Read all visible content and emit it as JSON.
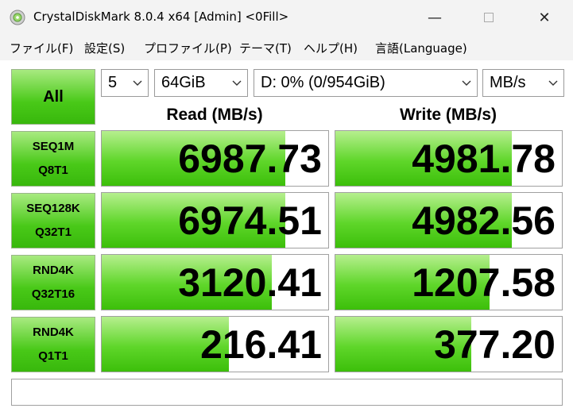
{
  "window": {
    "title": "CrystalDiskMark 8.0.4 x64 [Admin] <0Fill>",
    "min_symbol": "—",
    "close_symbol": "✕"
  },
  "menu": {
    "file": "ファイル(F)",
    "settings": "設定(S)",
    "profile": "プロファイル(P)",
    "theme": "テーマ(T)",
    "help": "ヘルプ(H)",
    "language": "言語(Language)"
  },
  "controls": {
    "all_label": "All",
    "count": "5",
    "size": "64GiB",
    "drive": "D: 0% (0/954GiB)",
    "unit": "MB/s"
  },
  "headers": {
    "read": "Read (MB/s)",
    "write": "Write (MB/s)"
  },
  "tests": [
    {
      "line1": "SEQ1M",
      "line2": "Q8T1",
      "read": "6987.73",
      "write": "4981.78",
      "read_fill": 0.81,
      "write_fill": 0.78
    },
    {
      "line1": "SEQ128K",
      "line2": "Q32T1",
      "read": "6974.51",
      "write": "4982.56",
      "read_fill": 0.81,
      "write_fill": 0.78
    },
    {
      "line1": "RND4K",
      "line2": "Q32T16",
      "read": "3120.41",
      "write": "1207.58",
      "read_fill": 0.75,
      "write_fill": 0.68
    },
    {
      "line1": "RND4K",
      "line2": "Q1T1",
      "read": "216.41",
      "write": "377.20",
      "read_fill": 0.56,
      "write_fill": 0.6
    }
  ],
  "status": "",
  "colors": {
    "button_green": "#49c918",
    "bar_green": "#5fd62a"
  }
}
